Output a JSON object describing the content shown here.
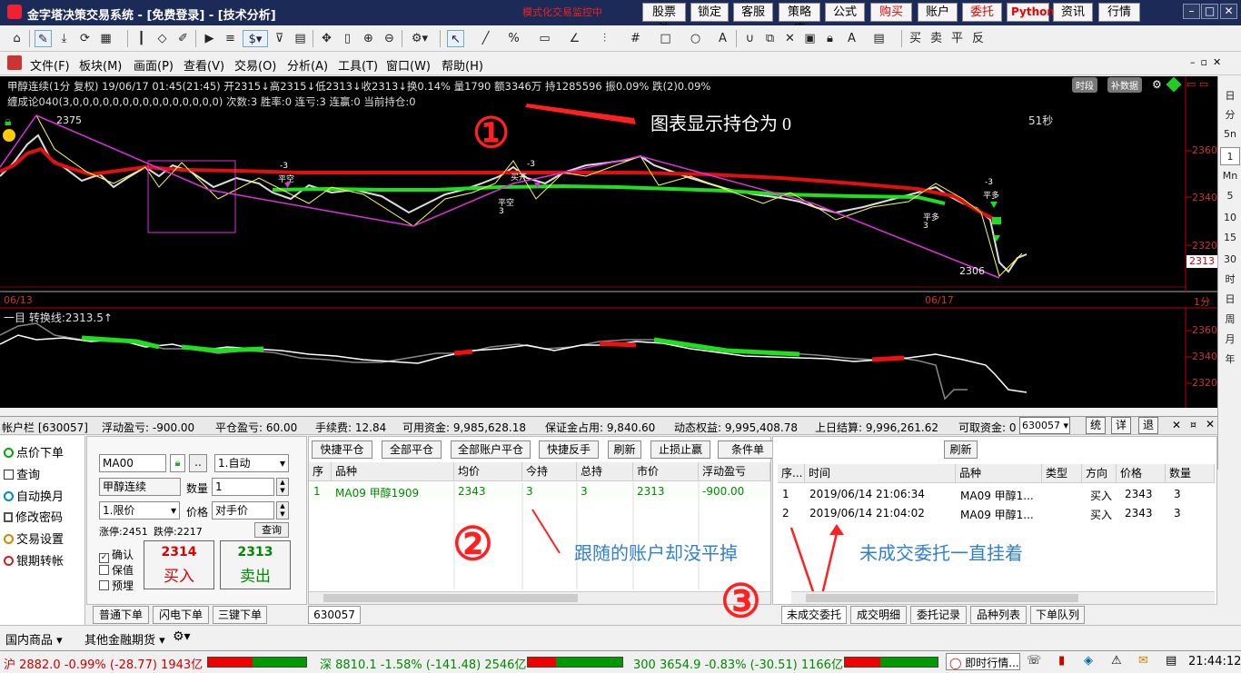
{
  "window": {
    "title": "金字塔决策交易系统 - [免费登录] - [技术分析]",
    "notice": "模式化交易监控中",
    "buttons": [
      "股票池",
      "锁定",
      "客服",
      "策略库",
      "公式",
      "购买",
      "账户",
      "委托",
      "Python",
      "资讯",
      "行情"
    ]
  },
  "menu": [
    "文件(F)",
    "板块(M)",
    "画面(P)",
    "查看(V)",
    "交易(O)",
    "分析(A)",
    "工具(T)",
    "窗口(W)",
    "帮助(H)"
  ],
  "toolbar": {
    "right_labels": [
      "买",
      "卖",
      "平",
      "反"
    ]
  },
  "chart": {
    "info_line1": "甲醇连续(1分 复权) 19/06/17 01:45(21:45) 开2315↓高2315↓低2313↓收2313↓换0.14% 量1790 额3346万 持1285596 振0.09% 跌(2)0.09%",
    "info_line2": "缠成论040(3,0,0,0,0,0,0,0,0,0,0,0,0,0,0,0) 次数:3 胜率:0 连亏:3 连赢:0 当前持仓:0",
    "tag_time": "时段",
    "tag_fill": "补数据",
    "annotation_top": "图表显示持仓为 0",
    "countdown": "51秒",
    "price_high_label": "2375",
    "price_low_label": "2306",
    "price_axis": [
      "2360",
      "2340",
      "2320"
    ],
    "current_price": "2313",
    "date_left": "06/13",
    "date_right": "06/17",
    "period": "1分",
    "lower_title": "一目 转换线:2313.5↑",
    "lower_axis": [
      "2360",
      "2340",
      "2320"
    ],
    "marks": [
      "-3",
      "平空",
      "-3",
      "买开",
      "平空",
      "3",
      "-3",
      "平多",
      "平多",
      "3"
    ]
  },
  "right_periods": [
    "日",
    "分",
    "5n",
    "1",
    "Mn",
    "5",
    "10",
    "15",
    "30",
    "时",
    "日",
    "周",
    "月",
    "年"
  ],
  "account_bar": {
    "account": "帐户栏 [630057]",
    "floating_pl": "浮动盈亏: -900.00",
    "close_pl": "平仓盈亏: 60.00",
    "fee": "手续费: 12.84",
    "available": "可用资金: 9,985,628.18",
    "margin": "保证金占用: 9,840.60",
    "equity": "动态权益: 9,995,408.78",
    "settlement": "上日结算: 9,996,261.62",
    "withdrawable": "可取资金: 0",
    "account_select": "630057",
    "btns": [
      "统",
      "详",
      "退"
    ]
  },
  "left_nav": [
    "点价下单",
    "查询",
    "自动换月",
    "修改密码",
    "交易设置",
    "银期转帐"
  ],
  "order_form": {
    "code": "MA00",
    "mode": "1.自动",
    "name": "甲醇连续",
    "qty_label": "数量",
    "qty": "1",
    "price_type": "1.限价",
    "price_label": "价格",
    "price": "对手价",
    "limit_up": "涨停:2451",
    "limit_down": "跌停:2217",
    "query": "查询",
    "checks": [
      {
        "label": "确认",
        "checked": true
      },
      {
        "label": "保值",
        "checked": false
      },
      {
        "label": "预埋",
        "checked": false
      }
    ],
    "buy_price": "2314",
    "buy_label": "买入",
    "sell_price": "2313",
    "sell_label": "卖出"
  },
  "positions": {
    "buttons": [
      "快捷平仓",
      "全部平仓",
      "全部账户平仓",
      "快捷反手",
      "刷新",
      "止损止赢",
      "条件单"
    ],
    "columns": [
      "序",
      "品种",
      "均价",
      "今持",
      "总持",
      "市价",
      "浮动盈亏"
    ],
    "rows": [
      [
        "1",
        "MA09 甲醇1909",
        "2343",
        "3",
        "3",
        "2313",
        "-900.00"
      ]
    ],
    "annotation": "跟随的账户却没平掉",
    "account_tab": "630057"
  },
  "orders": {
    "refresh": "刷新",
    "columns": [
      "序...",
      "时间",
      "品种",
      "类型",
      "方向",
      "价格",
      "数量"
    ],
    "rows": [
      [
        "1",
        "2019/06/14 21:06:34",
        "MA09 甲醇1...",
        "",
        "买入",
        "2343",
        "3"
      ],
      [
        "2",
        "2019/06/14 21:04:02",
        "MA09 甲醇1...",
        "",
        "买入",
        "2343",
        "3"
      ]
    ],
    "annotation": "未成交委托一直挂着"
  },
  "order_tabs_left": [
    "普通下单",
    "闪电下单",
    "三键下单"
  ],
  "order_tabs_right": [
    "未成交委托",
    "成交明细",
    "委托记录",
    "品种列表",
    "下单队列"
  ],
  "bottom_tabs": [
    "国内商品",
    "其他金融期货"
  ],
  "ticker": {
    "sh": "沪 2882.0 -0.99% (-28.77) 1943亿",
    "sz": "深 8810.1 -1.58% (-141.48) 2546亿",
    "hs300": "300 3654.9 -0.83% (-30.51) 1166亿",
    "realtime": "即时行情...",
    "clock": "21:44:12"
  }
}
